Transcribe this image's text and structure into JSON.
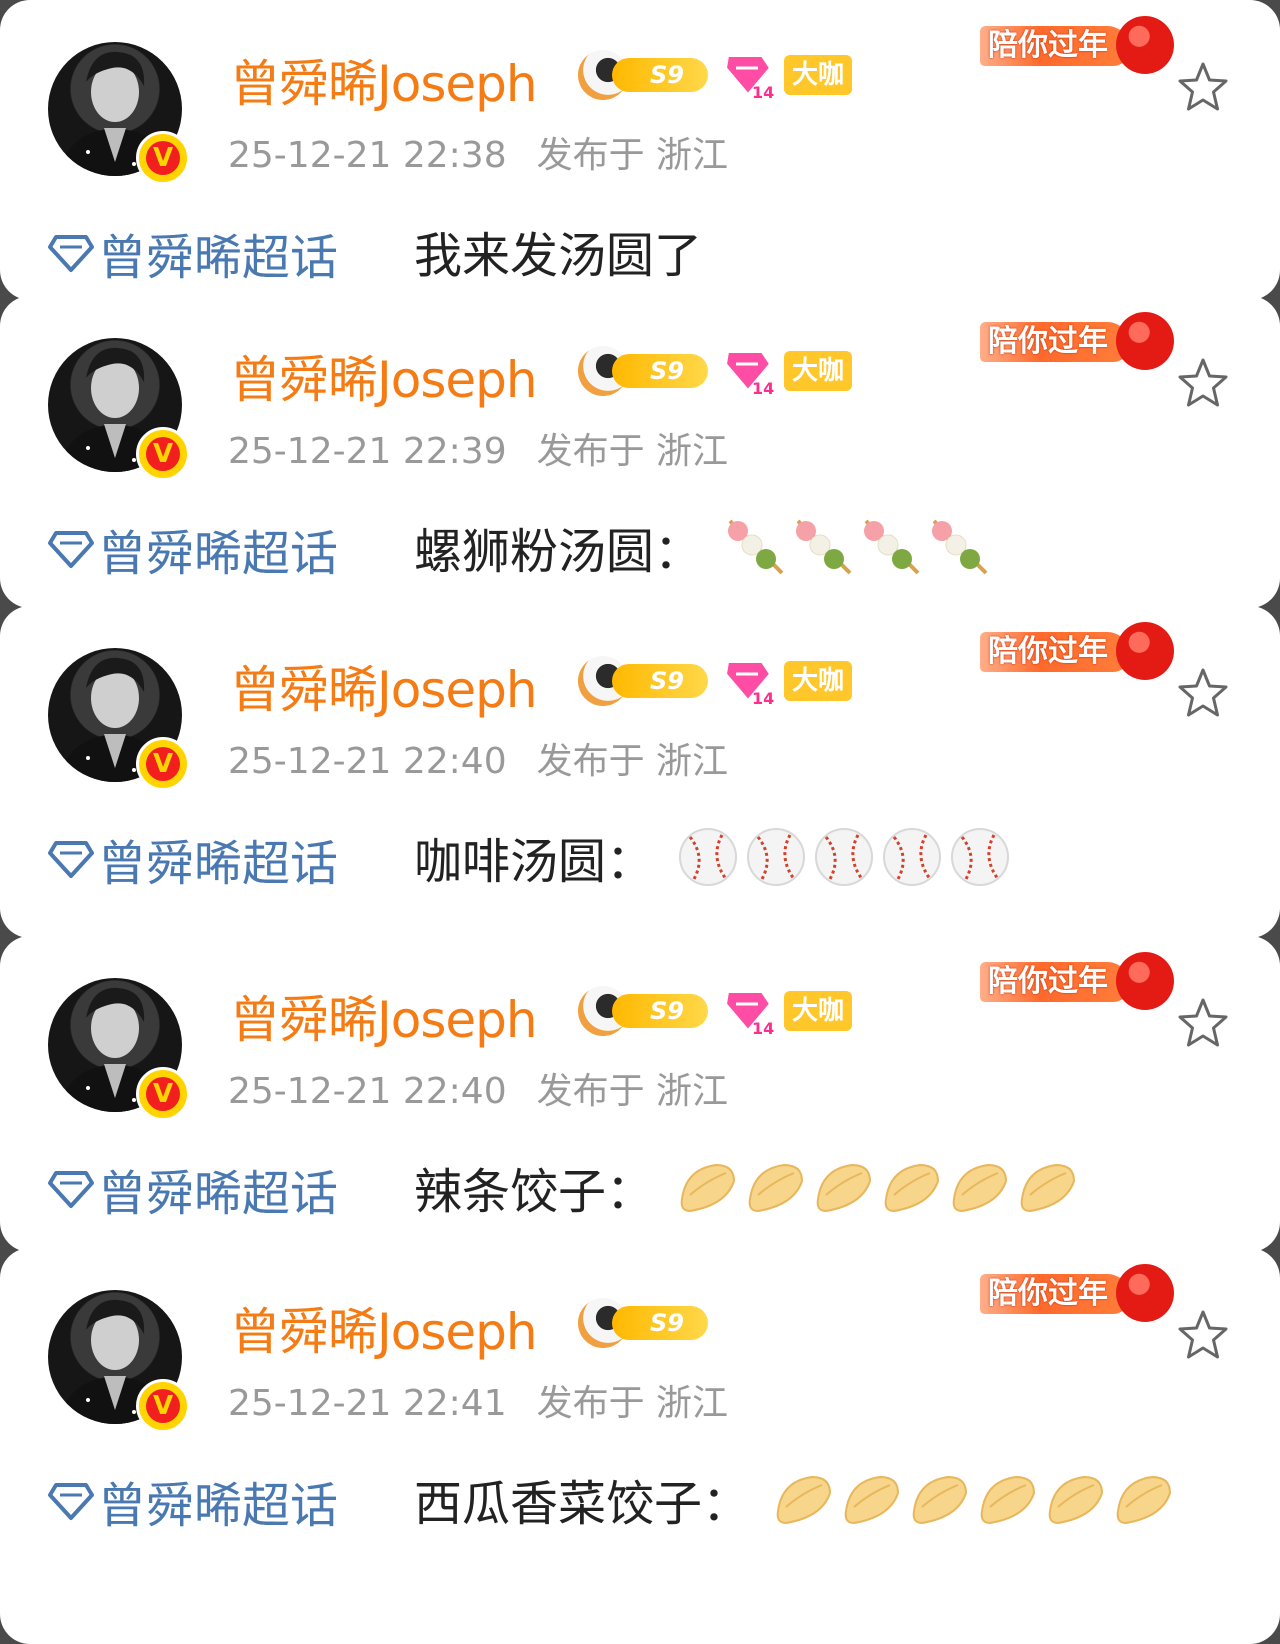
{
  "posts": [
    {
      "username": "曾舜晞Joseph",
      "level_badge": "S9",
      "fan_badge_number": "14",
      "daka_label": "大咖",
      "time": "25-12-21 22:38",
      "location": "发布于 浙江",
      "festival_label": "陪你过年",
      "topic": "曾舜晞超话",
      "content": "我来发汤圆了",
      "emoji": "none",
      "emoji_count": 0
    },
    {
      "username": "曾舜晞Joseph",
      "level_badge": "S9",
      "fan_badge_number": "14",
      "daka_label": "大咖",
      "time": "25-12-21 22:39",
      "location": "发布于 浙江",
      "festival_label": "陪你过年",
      "topic": "曾舜晞超话",
      "content": "螺狮粉汤圆：",
      "emoji": "dango-skewer",
      "emoji_count": 4
    },
    {
      "username": "曾舜晞Joseph",
      "level_badge": "S9",
      "fan_badge_number": "14",
      "daka_label": "大咖",
      "time": "25-12-21 22:40",
      "location": "发布于 浙江",
      "festival_label": "陪你过年",
      "topic": "曾舜晞超话",
      "content": "咖啡汤圆：",
      "emoji": "baseball",
      "emoji_count": 5
    },
    {
      "username": "曾舜晞Joseph",
      "level_badge": "S9",
      "fan_badge_number": "14",
      "daka_label": "大咖",
      "time": "25-12-21 22:40",
      "location": "发布于 浙江",
      "festival_label": "陪你过年",
      "topic": "曾舜晞超话",
      "content": "辣条饺子：",
      "emoji": "dumpling",
      "emoji_count": 6
    },
    {
      "username": "曾舜晞Joseph",
      "level_badge": "S9",
      "time": "25-12-21 22:41",
      "location": "发布于 浙江",
      "festival_label": "陪你过年",
      "topic": "曾舜晞超话",
      "content": "西瓜香菜饺子：",
      "emoji": "dumpling",
      "emoji_count": 6
    }
  ],
  "colors": {
    "username": "#f57c14",
    "topic": "#4a78b0",
    "timestamp": "#999999",
    "content": "#222222",
    "verified": "#ffd400"
  }
}
